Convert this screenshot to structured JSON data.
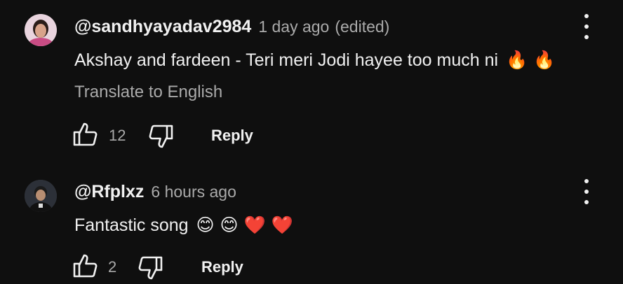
{
  "comments": [
    {
      "author": "@sandhyayadav2984",
      "time": "1 day ago",
      "edited": "(edited)",
      "text": "Akshay and fardeen - Teri meri Jodi hayee too much ni",
      "emojis": "🔥 🔥",
      "translate_label": "Translate to English",
      "likes": "12",
      "reply_label": "Reply",
      "avatar_colors": {
        "skin": "#d8a38a",
        "hair": "#2a1c18",
        "bg": "#e9d4de"
      }
    },
    {
      "author": "@Rfplxz",
      "time": "6 hours ago",
      "text": "Fantastic song",
      "emojis": "😊 😊 ❤️ ❤️",
      "likes": "2",
      "reply_label": "Reply",
      "avatar_colors": {
        "skin": "#b88e72",
        "hair": "#1b1b1b",
        "bg": "#2c3038"
      }
    }
  ],
  "icons": {
    "like": "thumb-up-icon",
    "dislike": "thumb-down-icon",
    "menu": "more-vert-icon"
  },
  "colors": {
    "background": "#0f0f0f",
    "primary_text": "#f1f1f1",
    "secondary_text": "#aaaaaa"
  }
}
